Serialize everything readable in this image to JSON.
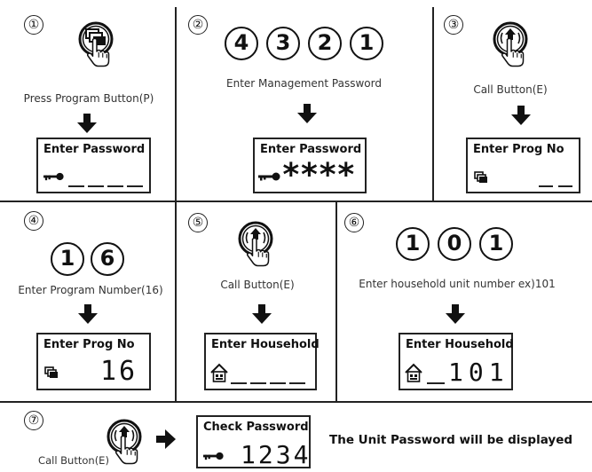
{
  "steps": [
    {
      "number": "①",
      "caption": "Press Program Button(P)",
      "icon": "program-button-icon",
      "screen_title": "Enter Password"
    },
    {
      "number": "②",
      "caption": "Enter Management Password",
      "digits": [
        "4",
        "3",
        "2",
        "1"
      ],
      "screen_title": "Enter Password",
      "screen_value": "****"
    },
    {
      "number": "③",
      "caption": "Call Button(E)",
      "icon": "call-button-icon",
      "screen_title": "Enter Prog No"
    },
    {
      "number": "④",
      "caption": "Enter Program Number(16)",
      "digits": [
        "1",
        "6"
      ],
      "screen_title": "Enter Prog No",
      "screen_value": "16"
    },
    {
      "number": "⑤",
      "caption": "Call Button(E)",
      "icon": "call-button-icon",
      "screen_title": "Enter Household"
    },
    {
      "number": "⑥",
      "caption": "Enter household unit number ex)101",
      "digits": [
        "1",
        "0",
        "1"
      ],
      "screen_title": "Enter Household",
      "screen_value": "101"
    },
    {
      "number": "⑦",
      "caption": "Call Button(E)",
      "icon": "call-button-icon",
      "screen_title": "Check Password",
      "screen_value": "1234",
      "note": "The Unit Password will be displayed"
    }
  ]
}
